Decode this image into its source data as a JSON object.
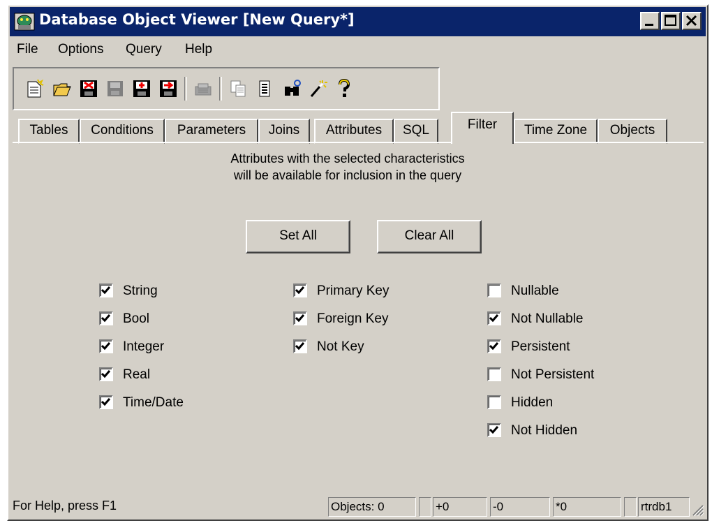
{
  "window": {
    "title": "Database Object Viewer [New Query*]",
    "controls": {
      "minimize": "_",
      "maximize": "□",
      "close": "×"
    }
  },
  "menu": [
    "File",
    "Options",
    "Query",
    "Help"
  ],
  "toolbar": {
    "buttons": [
      "new-query-icon",
      "open-folder-icon",
      "delete-icon",
      "save-disabled-icon",
      "save-icon",
      "save-as-icon",
      "print-disabled-icon",
      "copy-icon",
      "list-icon",
      "search-icon",
      "wizard-icon",
      "help-icon"
    ]
  },
  "tabs": [
    "Tables",
    "Conditions",
    "Parameters",
    "Joins",
    "Attributes",
    "SQL",
    "Filter",
    "Time Zone",
    "Objects"
  ],
  "active_tab": "Filter",
  "filter": {
    "info_line1": "Attributes with the selected characteristics",
    "info_line2": "will be available for inclusion in the query",
    "set_all": "Set All",
    "clear_all": "Clear All",
    "type_options": [
      {
        "label": "String",
        "checked": true
      },
      {
        "label": "Bool",
        "checked": true
      },
      {
        "label": "Integer",
        "checked": true
      },
      {
        "label": "Real",
        "checked": true
      },
      {
        "label": "Time/Date",
        "checked": true
      }
    ],
    "key_options": [
      {
        "label": "Primary Key",
        "checked": true
      },
      {
        "label": "Foreign Key",
        "checked": true
      },
      {
        "label": "Not Key",
        "checked": true
      }
    ],
    "property_options": [
      {
        "label": "Nullable",
        "checked": false
      },
      {
        "label": "Not Nullable",
        "checked": true
      },
      {
        "label": "Persistent",
        "checked": true
      },
      {
        "label": "Not Persistent",
        "checked": false
      },
      {
        "label": "Hidden",
        "checked": false
      },
      {
        "label": "Not Hidden",
        "checked": true
      }
    ]
  },
  "status": {
    "help": "For Help, press F1",
    "objects": "Objects: 0",
    "plus": "+0",
    "minus": "-0",
    "star": "*0",
    "db": "rtrdb1"
  }
}
